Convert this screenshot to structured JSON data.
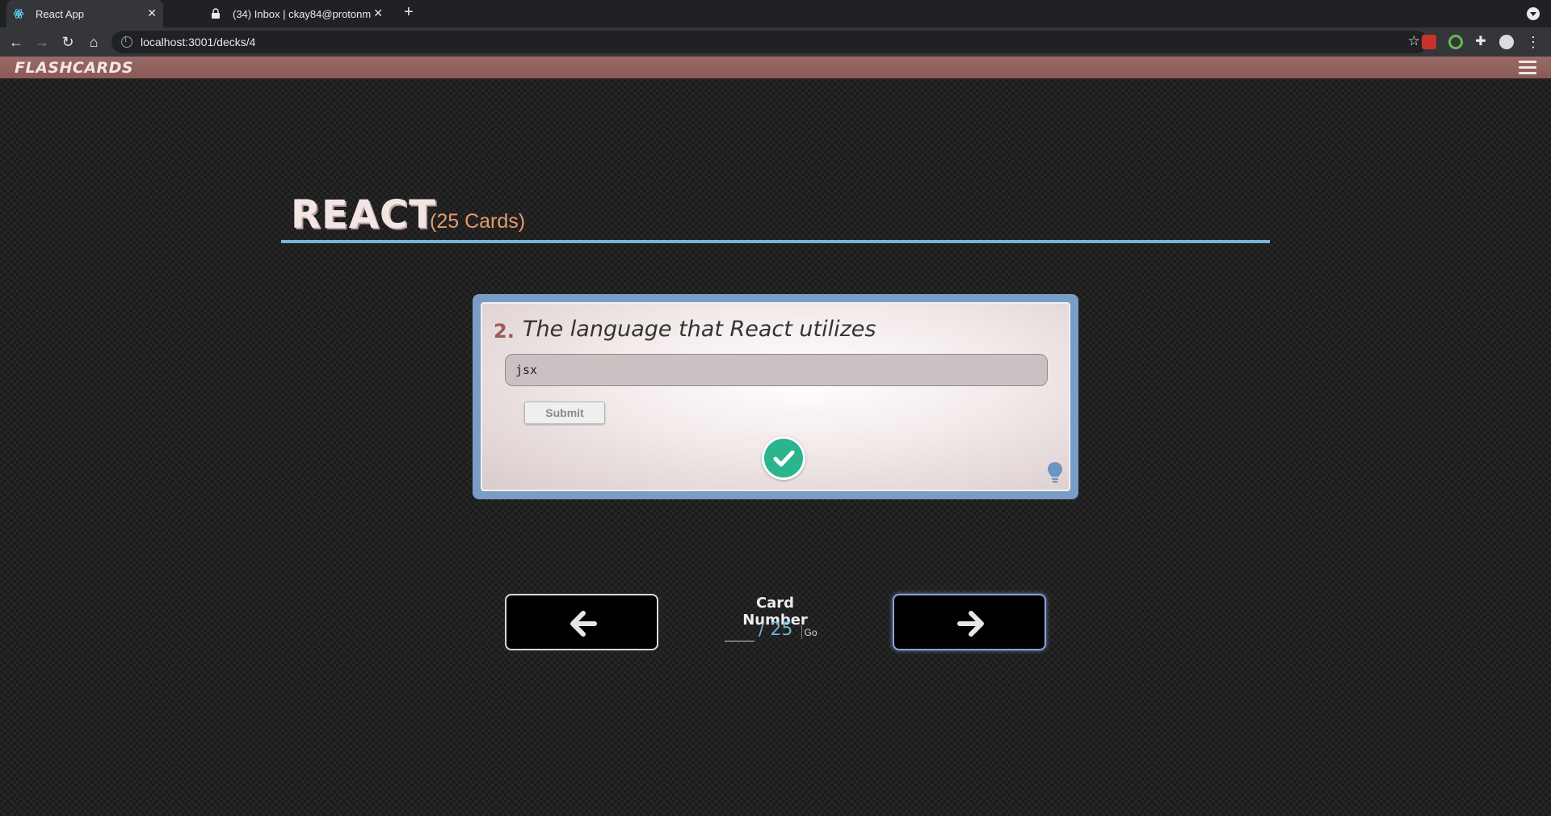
{
  "browser": {
    "tabs": [
      {
        "title": "React App",
        "active": true
      },
      {
        "title": "(34) Inbox | ckay84@protonm",
        "active": false
      }
    ],
    "url": "localhost:3001/decks/4"
  },
  "app": {
    "brand": "FLASHCARDS",
    "deck": {
      "name": "REACT",
      "count_label": "(25 Cards)"
    },
    "card": {
      "number_label": "2.",
      "question": "The language that React utilizes",
      "answer_value": "jsx",
      "submit_label": "Submit",
      "result": "correct"
    },
    "navigation": {
      "card_number_label": "Card Number",
      "card_input_value": "",
      "total_label": "/ 25",
      "go_label": "Go"
    }
  },
  "colors": {
    "topbar": "#8a5a56",
    "title_rule": "#76b6cf",
    "card_frame": "#7a9dc6",
    "check": "#2ab58e",
    "count": "#e69a6e"
  }
}
